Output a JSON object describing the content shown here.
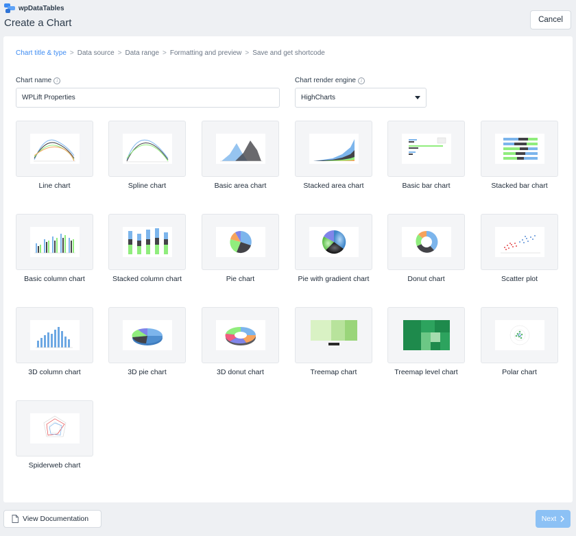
{
  "brand": {
    "name": "wpDataTables"
  },
  "page": {
    "title": "Create a Chart"
  },
  "header": {
    "cancel_label": "Cancel"
  },
  "steps": [
    {
      "label": "Chart title & type",
      "active": true
    },
    {
      "label": "Data source",
      "active": false
    },
    {
      "label": "Data range",
      "active": false
    },
    {
      "label": "Formatting and preview",
      "active": false
    },
    {
      "label": "Save and get shortcode",
      "active": false
    }
  ],
  "form": {
    "chart_name_label": "Chart name",
    "chart_name_value": "WPLift Properties",
    "render_engine_label": "Chart render engine",
    "render_engine_value": "HighCharts"
  },
  "chart_types": [
    {
      "label": "Line chart",
      "icon": "line-chart-icon"
    },
    {
      "label": "Spline chart",
      "icon": "spline-chart-icon"
    },
    {
      "label": "Basic area chart",
      "icon": "area-chart-icon"
    },
    {
      "label": "Stacked area chart",
      "icon": "stacked-area-chart-icon"
    },
    {
      "label": "Basic bar chart",
      "icon": "bar-chart-icon"
    },
    {
      "label": "Stacked bar chart",
      "icon": "stacked-bar-chart-icon"
    },
    {
      "label": "Basic column chart",
      "icon": "column-chart-icon"
    },
    {
      "label": "Stacked column chart",
      "icon": "stacked-column-chart-icon"
    },
    {
      "label": "Pie chart",
      "icon": "pie-chart-icon"
    },
    {
      "label": "Pie with gradient chart",
      "icon": "gradient-pie-chart-icon"
    },
    {
      "label": "Donut chart",
      "icon": "donut-chart-icon"
    },
    {
      "label": "Scatter plot",
      "icon": "scatter-plot-icon"
    },
    {
      "label": "3D column chart",
      "icon": "3d-column-chart-icon"
    },
    {
      "label": "3D pie chart",
      "icon": "3d-pie-chart-icon"
    },
    {
      "label": "3D donut chart",
      "icon": "3d-donut-chart-icon"
    },
    {
      "label": "Treemap chart",
      "icon": "treemap-chart-icon"
    },
    {
      "label": "Treemap level chart",
      "icon": "treemap-level-chart-icon"
    },
    {
      "label": "Polar chart",
      "icon": "polar-chart-icon"
    },
    {
      "label": "Spiderweb chart",
      "icon": "spiderweb-chart-icon"
    }
  ],
  "footer": {
    "doc_label": "View Documentation",
    "next_label": "Next"
  },
  "colors": {
    "accent": "#3d8bf2",
    "next_button": "#8cc1f5",
    "background": "#eef0f3"
  }
}
